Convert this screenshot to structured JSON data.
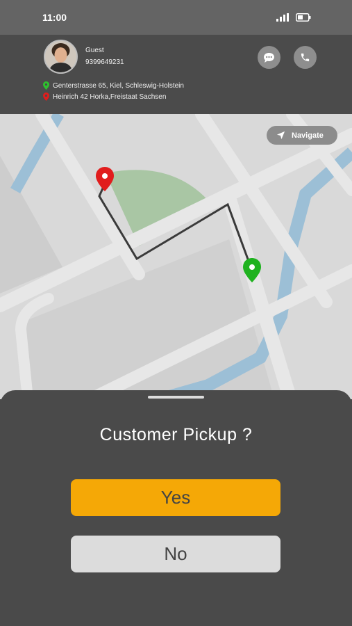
{
  "status_bar": {
    "time": "11:00",
    "signal_icon": "cellular-signal-icon",
    "battery_icon": "battery-icon"
  },
  "customer": {
    "name": "Guest",
    "phone": "9399649231",
    "chat_icon": "chat-bubble-icon",
    "call_icon": "phone-icon"
  },
  "addresses": {
    "pickup": "Genterstrasse 65, Kiel, Schleswig-Holstein",
    "pickup_color": "#2ec22e",
    "drop": "Heinrich 42 Horka,Freistaat Sachsen",
    "drop_color": "#e11d1d"
  },
  "map": {
    "navigate_label": "Navigate",
    "navigate_icon": "navigation-arrow-icon",
    "start_pin_color": "#e11d1d",
    "end_pin_color": "#1fb21f"
  },
  "sheet": {
    "title": "Customer Pickup ?",
    "yes_label": "Yes",
    "no_label": "No",
    "yes_color": "#f5a806"
  }
}
